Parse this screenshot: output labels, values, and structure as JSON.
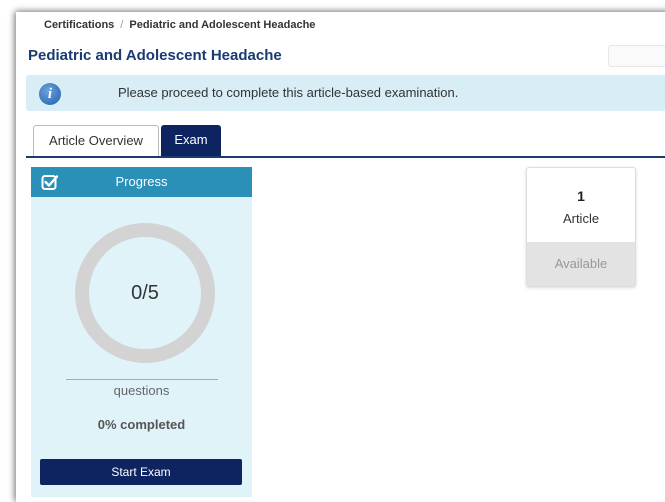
{
  "breadcrumb": {
    "root": "Certifications",
    "separator": "/",
    "current": "Pediatric and Adolescent Headache"
  },
  "page": {
    "title": "Pediatric and Adolescent Headache"
  },
  "banner": {
    "icon": "info-icon",
    "message": "Please proceed to complete this article-based examination."
  },
  "tabs": [
    {
      "label": "Article Overview",
      "active": false
    },
    {
      "label": "Exam",
      "active": true
    }
  ],
  "progress": {
    "title": "Progress",
    "icon": "checkbox-icon",
    "answered": 0,
    "total": 5,
    "value_text": "0/5",
    "unit_label": "questions",
    "completed_text": "0% completed",
    "completed_fraction": 0,
    "start_button": "Start Exam"
  },
  "article_card": {
    "count": "1",
    "label": "Article",
    "status": "Available"
  },
  "colors": {
    "brand_navy": "#0d2461",
    "title_blue": "#1a3a72",
    "header_teal": "#2a90b8",
    "panel_bg": "#dff3f9",
    "banner_bg": "#d9edf7",
    "ring_track": "#d3d3d3"
  }
}
